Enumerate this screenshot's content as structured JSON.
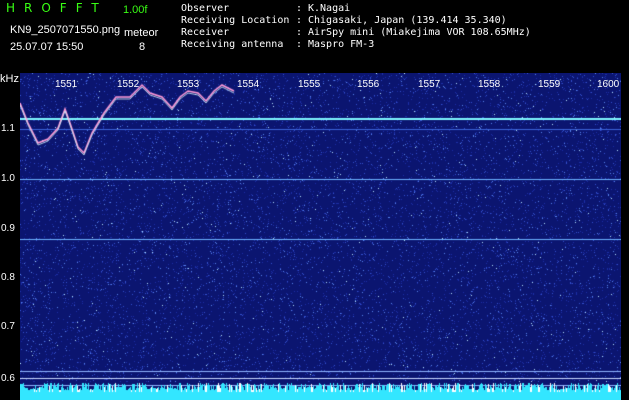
{
  "header": {
    "app_title": "HROFFT",
    "version": "1.00f",
    "file_name": "KN9_2507071550.png",
    "timestamp": "25.07.07 15:50",
    "meteor_label": "meteor",
    "meteor_count": "8"
  },
  "info": {
    "rows": [
      {
        "key": "Observer",
        "value": "K.Nagai"
      },
      {
        "key": "Receiving Location",
        "value": "Chigasaki, Japan (139.414 35.340)"
      },
      {
        "key": "Receiver",
        "value": "AirSpy mini (Miakejima VOR 108.65MHz)"
      },
      {
        "key": "Receiving antenna",
        "value": "Maspro FM-3"
      }
    ],
    "separator": ":"
  },
  "axes": {
    "y_unit": "kHz",
    "y_ticks": [
      "1.1",
      "1.0",
      "0.9",
      "0.8",
      "0.7",
      "0.6"
    ],
    "x_ticks": [
      "1551",
      "1552",
      "1553",
      "1554",
      "1555",
      "1556",
      "1557",
      "1558",
      "1559",
      "1600"
    ]
  },
  "colors": {
    "background": "#0b1570",
    "header_text": "#39ff14",
    "carrier_line": "#7ff6ff",
    "noise_bar": "#33e6ff"
  }
}
